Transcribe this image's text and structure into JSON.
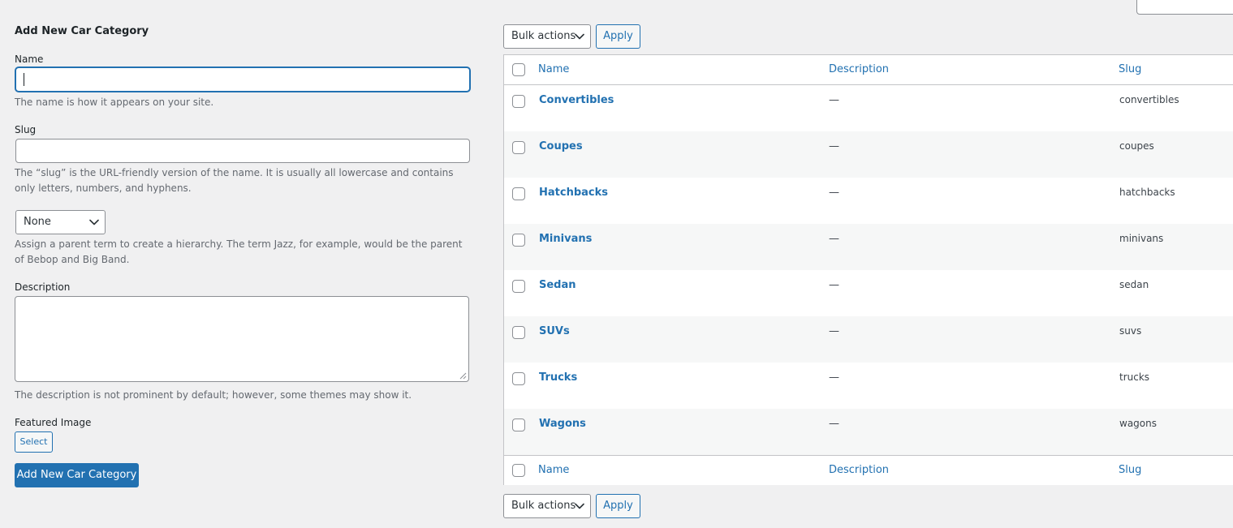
{
  "form": {
    "heading": "Add New Car Category",
    "name_label": "Name",
    "name_value": "",
    "name_help": "The name is how it appears on your site.",
    "slug_label": "Slug",
    "slug_value": "",
    "slug_help": "The “slug” is the URL-friendly version of the name. It is usually all lowercase and contains only letters, numbers, and hyphens.",
    "parent_selected": "None",
    "parent_help": "Assign a parent term to create a hierarchy. The term Jazz, for example, would be the parent of Bebop and Big Band.",
    "description_label": "Description",
    "description_value": "",
    "description_help": "The description is not prominent by default; however, some themes may show it.",
    "featured_image_label": "Featured Image",
    "select_button": "Select",
    "submit_button": "Add New Car Category"
  },
  "table": {
    "bulk_actions_top": "Bulk actions",
    "apply_top": "Apply",
    "bulk_actions_bottom": "Bulk actions",
    "apply_bottom": "Apply",
    "columns": {
      "name": "Name",
      "description": "Description",
      "slug": "Slug"
    },
    "rows": [
      {
        "name": "Convertibles",
        "description": "—",
        "slug": "convertibles"
      },
      {
        "name": "Coupes",
        "description": "—",
        "slug": "coupes"
      },
      {
        "name": "Hatchbacks",
        "description": "—",
        "slug": "hatchbacks"
      },
      {
        "name": "Minivans",
        "description": "—",
        "slug": "minivans"
      },
      {
        "name": "Sedan",
        "description": "—",
        "slug": "sedan"
      },
      {
        "name": "SUVs",
        "description": "—",
        "slug": "suvs"
      },
      {
        "name": "Trucks",
        "description": "—",
        "slug": "trucks"
      },
      {
        "name": "Wagons",
        "description": "—",
        "slug": "wagons"
      }
    ]
  },
  "colors": {
    "background": "#f0f0f1",
    "link": "#2271b1",
    "primary_button": "#2271b1",
    "row_alt": "#f6f7f7"
  }
}
